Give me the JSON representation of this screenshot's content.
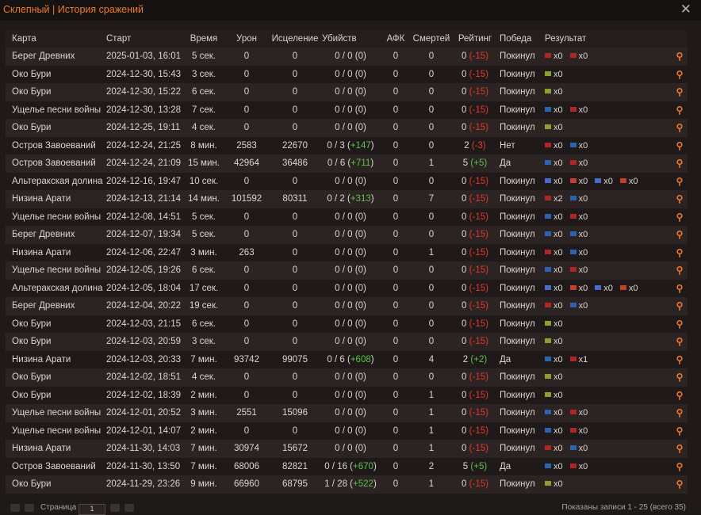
{
  "title": "Склепный | История сражений",
  "headers": [
    "Карта",
    "Старт",
    "Время",
    "Урон",
    "Исцеление",
    "Убийств",
    "АФК",
    "Смертей",
    "Рейтинг",
    "Победа",
    "Результат"
  ],
  "rows": [
    {
      "map": "Берег Древних",
      "start": "2025-01-03, 16:01",
      "time": "5 сек.",
      "dmg": "0",
      "heal": "0",
      "kills": "0 / 0 (0)",
      "kd": "",
      "afk": "0",
      "deaths": "0",
      "rating": "0",
      "rd": "(-15)",
      "rdc": "neg",
      "win": "Покинул",
      "res": [
        {
          "c": "#b02626",
          "t": "x0"
        },
        {
          "c": "#b02626",
          "t": "x0"
        }
      ]
    },
    {
      "map": "Око Бури",
      "start": "2024-12-30, 15:43",
      "time": "3 сек.",
      "dmg": "0",
      "heal": "0",
      "kills": "0 / 0 (0)",
      "kd": "",
      "afk": "0",
      "deaths": "0",
      "rating": "0",
      "rd": "(-15)",
      "rdc": "neg",
      "win": "Покинул",
      "res": [
        {
          "c": "#8aa030",
          "t": "x0"
        }
      ]
    },
    {
      "map": "Око Бури",
      "start": "2024-12-30, 15:22",
      "time": "6 сек.",
      "dmg": "0",
      "heal": "0",
      "kills": "0 / 0 (0)",
      "kd": "",
      "afk": "0",
      "deaths": "0",
      "rating": "0",
      "rd": "(-15)",
      "rdc": "neg",
      "win": "Покинул",
      "res": [
        {
          "c": "#8aa030",
          "t": "x0"
        }
      ]
    },
    {
      "map": "Ущелье песни войны",
      "start": "2024-12-30, 13:28",
      "time": "7 сек.",
      "dmg": "0",
      "heal": "0",
      "kills": "0 / 0 (0)",
      "kd": "",
      "afk": "0",
      "deaths": "0",
      "rating": "0",
      "rd": "(-15)",
      "rdc": "neg",
      "win": "Покинул",
      "res": [
        {
          "c": "#2a64b0",
          "t": "x0"
        },
        {
          "c": "#b02626",
          "t": "x0"
        }
      ]
    },
    {
      "map": "Око Бури",
      "start": "2024-12-25, 19:11",
      "time": "4 сек.",
      "dmg": "0",
      "heal": "0",
      "kills": "0 / 0 (0)",
      "kd": "",
      "afk": "0",
      "deaths": "0",
      "rating": "0",
      "rd": "(-15)",
      "rdc": "neg",
      "win": "Покинул",
      "res": [
        {
          "c": "#8aa030",
          "t": "x0"
        }
      ]
    },
    {
      "map": "Остров Завоеваний",
      "start": "2024-12-24, 21:25",
      "time": "8 мин.",
      "dmg": "2583",
      "heal": "22670",
      "kills": "0 / 3 (",
      "kd": "+147",
      "afk": "0",
      "deaths": "0",
      "rating": "2",
      "rd": "(-3)",
      "rdc": "neg",
      "win": "Нет",
      "res": [
        {
          "c": "#b02626",
          "t": "x0"
        },
        {
          "c": "#2a64b0",
          "t": "x0"
        }
      ]
    },
    {
      "map": "Остров Завоеваний",
      "start": "2024-12-24, 21:09",
      "time": "15 мин.",
      "dmg": "42964",
      "heal": "36486",
      "kills": "0 / 6 (",
      "kd": "+711",
      "afk": "0",
      "deaths": "1",
      "rating": "5",
      "rd": "(+5)",
      "rdc": "pos",
      "win": "Да",
      "res": [
        {
          "c": "#2a64b0",
          "t": "x0"
        },
        {
          "c": "#b02626",
          "t": "x0"
        }
      ]
    },
    {
      "map": "Альтеракская долина",
      "start": "2024-12-16, 19:47",
      "time": "10 сек.",
      "dmg": "0",
      "heal": "0",
      "kills": "0 / 0 (0)",
      "kd": "",
      "afk": "0",
      "deaths": "0",
      "rating": "0",
      "rd": "(-15)",
      "rdc": "neg",
      "win": "Покинул",
      "res": [
        {
          "c": "#4a6ad0",
          "t": "x0"
        },
        {
          "c": "#c0402a",
          "t": "x0"
        },
        {
          "c": "#4a6ad0",
          "t": "x0"
        },
        {
          "c": "#c0402a",
          "t": "x0"
        }
      ]
    },
    {
      "map": "Низина Арати",
      "start": "2024-12-13, 21:14",
      "time": "14 мин.",
      "dmg": "101592",
      "heal": "80311",
      "kills": "0 / 2 (",
      "kd": "+313",
      "afk": "0",
      "deaths": "7",
      "rating": "0",
      "rd": "(-15)",
      "rdc": "neg",
      "win": "Покинул",
      "res": [
        {
          "c": "#b02626",
          "t": "x2"
        },
        {
          "c": "#2a64b0",
          "t": "x0"
        }
      ]
    },
    {
      "map": "Ущелье песни войны",
      "start": "2024-12-08, 14:51",
      "time": "5 сек.",
      "dmg": "0",
      "heal": "0",
      "kills": "0 / 0 (0)",
      "kd": "",
      "afk": "0",
      "deaths": "0",
      "rating": "0",
      "rd": "(-15)",
      "rdc": "neg",
      "win": "Покинул",
      "res": [
        {
          "c": "#2a64b0",
          "t": "x0"
        },
        {
          "c": "#b02626",
          "t": "x0"
        }
      ]
    },
    {
      "map": "Берег Древних",
      "start": "2024-12-07, 19:34",
      "time": "5 сек.",
      "dmg": "0",
      "heal": "0",
      "kills": "0 / 0 (0)",
      "kd": "",
      "afk": "0",
      "deaths": "0",
      "rating": "0",
      "rd": "(-15)",
      "rdc": "neg",
      "win": "Покинул",
      "res": [
        {
          "c": "#2a64b0",
          "t": "x0"
        },
        {
          "c": "#2a64b0",
          "t": "x0"
        }
      ]
    },
    {
      "map": "Низина Арати",
      "start": "2024-12-06, 22:47",
      "time": "3 мин.",
      "dmg": "263",
      "heal": "0",
      "kills": "0 / 0 (0)",
      "kd": "",
      "afk": "0",
      "deaths": "1",
      "rating": "0",
      "rd": "(-15)",
      "rdc": "neg",
      "win": "Покинул",
      "res": [
        {
          "c": "#b02626",
          "t": "x0"
        },
        {
          "c": "#2a64b0",
          "t": "x0"
        }
      ]
    },
    {
      "map": "Ущелье песни войны",
      "start": "2024-12-05, 19:26",
      "time": "6 сек.",
      "dmg": "0",
      "heal": "0",
      "kills": "0 / 0 (0)",
      "kd": "",
      "afk": "0",
      "deaths": "0",
      "rating": "0",
      "rd": "(-15)",
      "rdc": "neg",
      "win": "Покинул",
      "res": [
        {
          "c": "#2a64b0",
          "t": "x0"
        },
        {
          "c": "#b02626",
          "t": "x0"
        }
      ]
    },
    {
      "map": "Альтеракская долина",
      "start": "2024-12-05, 18:04",
      "time": "17 сек.",
      "dmg": "0",
      "heal": "0",
      "kills": "0 / 0 (0)",
      "kd": "",
      "afk": "0",
      "deaths": "0",
      "rating": "0",
      "rd": "(-15)",
      "rdc": "neg",
      "win": "Покинул",
      "res": [
        {
          "c": "#4a6ad0",
          "t": "x0"
        },
        {
          "c": "#c0402a",
          "t": "x0"
        },
        {
          "c": "#4a6ad0",
          "t": "x0"
        },
        {
          "c": "#c0402a",
          "t": "x0"
        }
      ]
    },
    {
      "map": "Берег Древних",
      "start": "2024-12-04, 20:22",
      "time": "19 сек.",
      "dmg": "0",
      "heal": "0",
      "kills": "0 / 0 (0)",
      "kd": "",
      "afk": "0",
      "deaths": "0",
      "rating": "0",
      "rd": "(-15)",
      "rdc": "neg",
      "win": "Покинул",
      "res": [
        {
          "c": "#b02626",
          "t": "x0"
        },
        {
          "c": "#2a64b0",
          "t": "x0"
        }
      ]
    },
    {
      "map": "Око Бури",
      "start": "2024-12-03, 21:15",
      "time": "6 сек.",
      "dmg": "0",
      "heal": "0",
      "kills": "0 / 0 (0)",
      "kd": "",
      "afk": "0",
      "deaths": "0",
      "rating": "0",
      "rd": "(-15)",
      "rdc": "neg",
      "win": "Покинул",
      "res": [
        {
          "c": "#8aa030",
          "t": "x0"
        }
      ]
    },
    {
      "map": "Око Бури",
      "start": "2024-12-03, 20:59",
      "time": "3 сек.",
      "dmg": "0",
      "heal": "0",
      "kills": "0 / 0 (0)",
      "kd": "",
      "afk": "0",
      "deaths": "0",
      "rating": "0",
      "rd": "(-15)",
      "rdc": "neg",
      "win": "Покинул",
      "res": [
        {
          "c": "#8aa030",
          "t": "x0"
        }
      ]
    },
    {
      "map": "Низина Арати",
      "start": "2024-12-03, 20:33",
      "time": "7 мин.",
      "dmg": "93742",
      "heal": "99075",
      "kills": "0 / 6 (",
      "kd": "+608",
      "afk": "0",
      "deaths": "4",
      "rating": "2",
      "rd": "(+2)",
      "rdc": "pos",
      "win": "Да",
      "res": [
        {
          "c": "#2a64b0",
          "t": "x0"
        },
        {
          "c": "#b02626",
          "t": "x1"
        }
      ]
    },
    {
      "map": "Око Бури",
      "start": "2024-12-02, 18:51",
      "time": "4 сек.",
      "dmg": "0",
      "heal": "0",
      "kills": "0 / 0 (0)",
      "kd": "",
      "afk": "0",
      "deaths": "0",
      "rating": "0",
      "rd": "(-15)",
      "rdc": "neg",
      "win": "Покинул",
      "res": [
        {
          "c": "#8aa030",
          "t": "x0"
        }
      ]
    },
    {
      "map": "Око Бури",
      "start": "2024-12-02, 18:39",
      "time": "2 мин.",
      "dmg": "0",
      "heal": "0",
      "kills": "0 / 0 (0)",
      "kd": "",
      "afk": "0",
      "deaths": "1",
      "rating": "0",
      "rd": "(-15)",
      "rdc": "neg",
      "win": "Покинул",
      "res": [
        {
          "c": "#8aa030",
          "t": "x0"
        }
      ]
    },
    {
      "map": "Ущелье песни войны",
      "start": "2024-12-01, 20:52",
      "time": "3 мин.",
      "dmg": "2551",
      "heal": "15096",
      "kills": "0 / 0 (0)",
      "kd": "",
      "afk": "0",
      "deaths": "1",
      "rating": "0",
      "rd": "(-15)",
      "rdc": "neg",
      "win": "Покинул",
      "res": [
        {
          "c": "#2a64b0",
          "t": "x0"
        },
        {
          "c": "#b02626",
          "t": "x0"
        }
      ]
    },
    {
      "map": "Ущелье песни войны",
      "start": "2024-12-01, 14:07",
      "time": "2 мин.",
      "dmg": "0",
      "heal": "0",
      "kills": "0 / 0 (0)",
      "kd": "",
      "afk": "0",
      "deaths": "1",
      "rating": "0",
      "rd": "(-15)",
      "rdc": "neg",
      "win": "Покинул",
      "res": [
        {
          "c": "#2a64b0",
          "t": "x0"
        },
        {
          "c": "#b02626",
          "t": "x0"
        }
      ]
    },
    {
      "map": "Низина Арати",
      "start": "2024-11-30, 14:03",
      "time": "7 мин.",
      "dmg": "30974",
      "heal": "15672",
      "kills": "0 / 0 (0)",
      "kd": "",
      "afk": "0",
      "deaths": "1",
      "rating": "0",
      "rd": "(-15)",
      "rdc": "neg",
      "win": "Покинул",
      "res": [
        {
          "c": "#b02626",
          "t": "x0"
        },
        {
          "c": "#2a64b0",
          "t": "x0"
        }
      ]
    },
    {
      "map": "Остров Завоеваний",
      "start": "2024-11-30, 13:50",
      "time": "7 мин.",
      "dmg": "68006",
      "heal": "82821",
      "kills": "0 / 16 (",
      "kd": "+670",
      "afk": "0",
      "deaths": "2",
      "rating": "5",
      "rd": "(+5)",
      "rdc": "pos",
      "win": "Да",
      "res": [
        {
          "c": "#2a64b0",
          "t": "x0"
        },
        {
          "c": "#b02626",
          "t": "x0"
        }
      ]
    },
    {
      "map": "Око Бури",
      "start": "2024-11-29, 23:26",
      "time": "9 мин.",
      "dmg": "66960",
      "heal": "68795",
      "kills": "1 / 28 (",
      "kd": "+522",
      "afk": "0",
      "deaths": "1",
      "rating": "0",
      "rd": "(-15)",
      "rdc": "neg",
      "win": "Покинул",
      "res": [
        {
          "c": "#8aa030",
          "t": "x0"
        }
      ]
    }
  ],
  "footer": {
    "page_label": "Страница",
    "page_value": "1",
    "records": "Показаны записи 1 - 25 (всего 35)"
  }
}
